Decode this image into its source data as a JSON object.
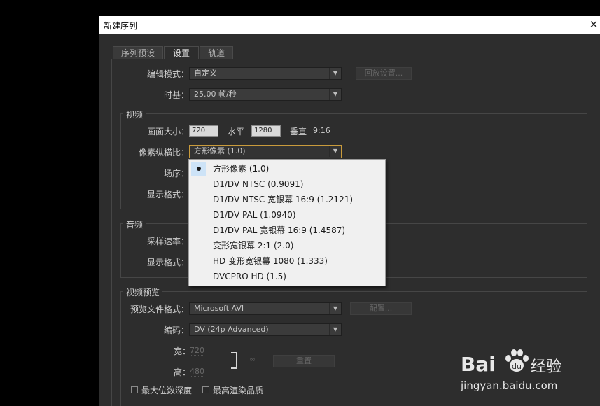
{
  "window": {
    "title": "新建序列"
  },
  "tabs": [
    {
      "label": "序列预设"
    },
    {
      "label": "设置"
    },
    {
      "label": "轨道"
    }
  ],
  "settings": {
    "edit_mode_label": "编辑模式：",
    "edit_mode_value": "自定义",
    "playback_button": "回放设置...",
    "timebase_label": "时基：",
    "timebase_value": "25.00 帧/秒"
  },
  "video": {
    "group_title": "视频",
    "frame_size_label": "画面大小：",
    "width_value": "720",
    "horizontal_label": "水平",
    "height_value": "1280",
    "vertical_label": "垂直",
    "aspect": "9:16",
    "pixel_aspect_label": "像素纵横比：",
    "pixel_aspect_value": "方形像素 (1.0)",
    "field_order_label": "场序：",
    "display_format_label": "显示格式："
  },
  "audio": {
    "group_title": "音频",
    "sample_rate_label": "采样速率：",
    "display_format_label": "显示格式："
  },
  "preview": {
    "group_title": "视频预览",
    "file_format_label": "预览文件格式：",
    "file_format_value": "Microsoft AVI",
    "config_button": "配置...",
    "codec_label": "编码：",
    "codec_value": "DV (24p Advanced)",
    "width_label": "宽：",
    "width_value": "720",
    "height_label": "高：",
    "height_value": "480",
    "reset_button": "重置",
    "max_bit_depth_label": "最大位数深度",
    "max_render_quality_label": "最高渲染品质"
  },
  "dropdown": {
    "options": [
      "方形像素 (1.0)",
      "D1/DV NTSC (0.9091)",
      "D1/DV NTSC 宽银幕 16:9 (1.2121)",
      "D1/DV PAL (1.0940)",
      "D1/DV PAL 宽银幕 16:9 (1.4587)",
      "变形宽银幕 2:1 (2.0)",
      "HD 变形宽银幕 1080 (1.333)",
      "DVCPRO HD (1.5)"
    ],
    "selected_index": 0
  },
  "watermark": {
    "brand_left": "Bai",
    "brand_right": "经验",
    "url": "jingyan.baidu.com"
  }
}
